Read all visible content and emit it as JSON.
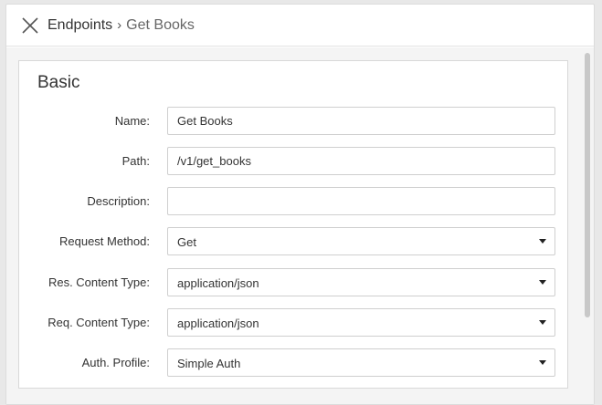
{
  "header": {
    "breadcrumb_root": "Endpoints",
    "breadcrumb_sep": "›",
    "breadcrumb_current": "Get Books"
  },
  "section": {
    "title": "Basic"
  },
  "form": {
    "name": {
      "label": "Name:",
      "value": "Get Books"
    },
    "path": {
      "label": "Path:",
      "value": "/v1/get_books"
    },
    "description": {
      "label": "Description:",
      "value": ""
    },
    "request_method": {
      "label": "Request Method:",
      "value": "Get"
    },
    "res_content_type": {
      "label": "Res. Content Type:",
      "value": "application/json"
    },
    "req_content_type": {
      "label": "Req. Content Type:",
      "value": "application/json"
    },
    "auth_profile": {
      "label": "Auth. Profile:",
      "value": "Simple Auth"
    }
  },
  "icons": {
    "close": "close-icon",
    "dropdown": "chevron-down-icon"
  },
  "colors": {
    "panel_bg": "#ffffff",
    "content_bg": "#f4f4f4",
    "border": "#cfcfcf"
  }
}
